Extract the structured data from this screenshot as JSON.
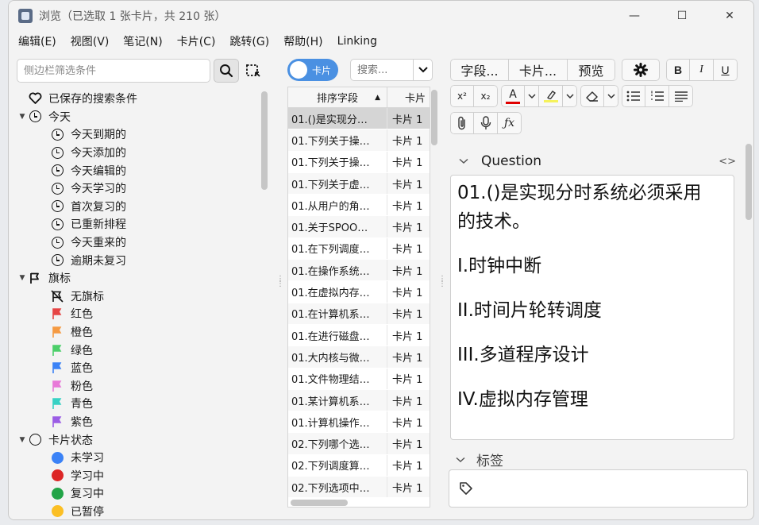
{
  "window": {
    "title": "浏览（已选取 1 张卡片，共 210 张）",
    "minimize": "—",
    "maximize": "☐",
    "close": "✕"
  },
  "menu": [
    "编辑(E)",
    "视图(V)",
    "笔记(N)",
    "卡片(C)",
    "跳转(G)",
    "帮助(H)",
    "Linking"
  ],
  "sidebar": {
    "filter_placeholder": "侧边栏筛选条件",
    "saved_searches": "已保存的搜索条件",
    "today": {
      "label": "今天",
      "items": [
        "今天到期的",
        "今天添加的",
        "今天编辑的",
        "今天学习的",
        "首次复习的",
        "已重新排程",
        "今天重来的",
        "逾期未复习"
      ]
    },
    "flags": {
      "label": "旗标",
      "items": [
        {
          "label": "无旗标",
          "color": "none"
        },
        {
          "label": "红色",
          "color": "#e64545"
        },
        {
          "label": "橙色",
          "color": "#f59a42"
        },
        {
          "label": "绿色",
          "color": "#4ccf6a"
        },
        {
          "label": "蓝色",
          "color": "#3b82f6"
        },
        {
          "label": "粉色",
          "color": "#e879d8"
        },
        {
          "label": "青色",
          "color": "#38d1c4"
        },
        {
          "label": "紫色",
          "color": "#9b5de5"
        }
      ]
    },
    "card_state": {
      "label": "卡片状态",
      "items": [
        {
          "label": "未学习",
          "color": "#3b82f6"
        },
        {
          "label": "学习中",
          "color": "#dc2626"
        },
        {
          "label": "复习中",
          "color": "#22a447"
        },
        {
          "label": "已暂停",
          "color": "#fbbf24"
        }
      ]
    }
  },
  "cardlist": {
    "toggle_label": "卡片",
    "search_placeholder": "搜索...",
    "columns": [
      "排序字段",
      "卡片"
    ],
    "rows": [
      {
        "sort": "01.()是实现分…",
        "card": "卡片 1"
      },
      {
        "sort": "01.下列关于操…",
        "card": "卡片 1"
      },
      {
        "sort": "01.下列关于操…",
        "card": "卡片 1"
      },
      {
        "sort": "01.下列关于虚…",
        "card": "卡片 1"
      },
      {
        "sort": "01.从用户的角…",
        "card": "卡片 1"
      },
      {
        "sort": "01.关于SPOO…",
        "card": "卡片 1"
      },
      {
        "sort": "01.在下列调度…",
        "card": "卡片 1"
      },
      {
        "sort": "01.在操作系统…",
        "card": "卡片 1"
      },
      {
        "sort": "01.在虚拟内存…",
        "card": "卡片 1"
      },
      {
        "sort": "01.在计算机系…",
        "card": "卡片 1"
      },
      {
        "sort": "01.在进行磁盘…",
        "card": "卡片 1"
      },
      {
        "sort": "01.大内核与微…",
        "card": "卡片 1"
      },
      {
        "sort": "01.文件物理结…",
        "card": "卡片 1"
      },
      {
        "sort": "01.某计算机系…",
        "card": "卡片 1"
      },
      {
        "sort": "01.计算机操作…",
        "card": "卡片 1"
      },
      {
        "sort": "02.下列哪个选…",
        "card": "卡片 1"
      },
      {
        "sort": "02.下列调度算…",
        "card": "卡片 1"
      },
      {
        "sort": "02.下列选项中…",
        "card": "卡片 1"
      }
    ]
  },
  "editor": {
    "fields_button": "字段...",
    "cards_button": "卡片...",
    "preview_button": "预览",
    "bold": "B",
    "italic": "I",
    "underline": "U",
    "superscript": "x²",
    "subscript": "x₂",
    "font_color_glyph": "A",
    "font_color": "#e00000",
    "highlight_color": "#f5f25c",
    "question_label": "Question",
    "question_lines": [
      "01.()是实现分时系统必须采用",
      "的技术。",
      "I.时钟中断",
      "II.时间片轮转调度",
      "III.多道程序设计",
      "IV.虚拟内存管理"
    ],
    "tags_label": "标签",
    "html_toggle": "<>"
  }
}
